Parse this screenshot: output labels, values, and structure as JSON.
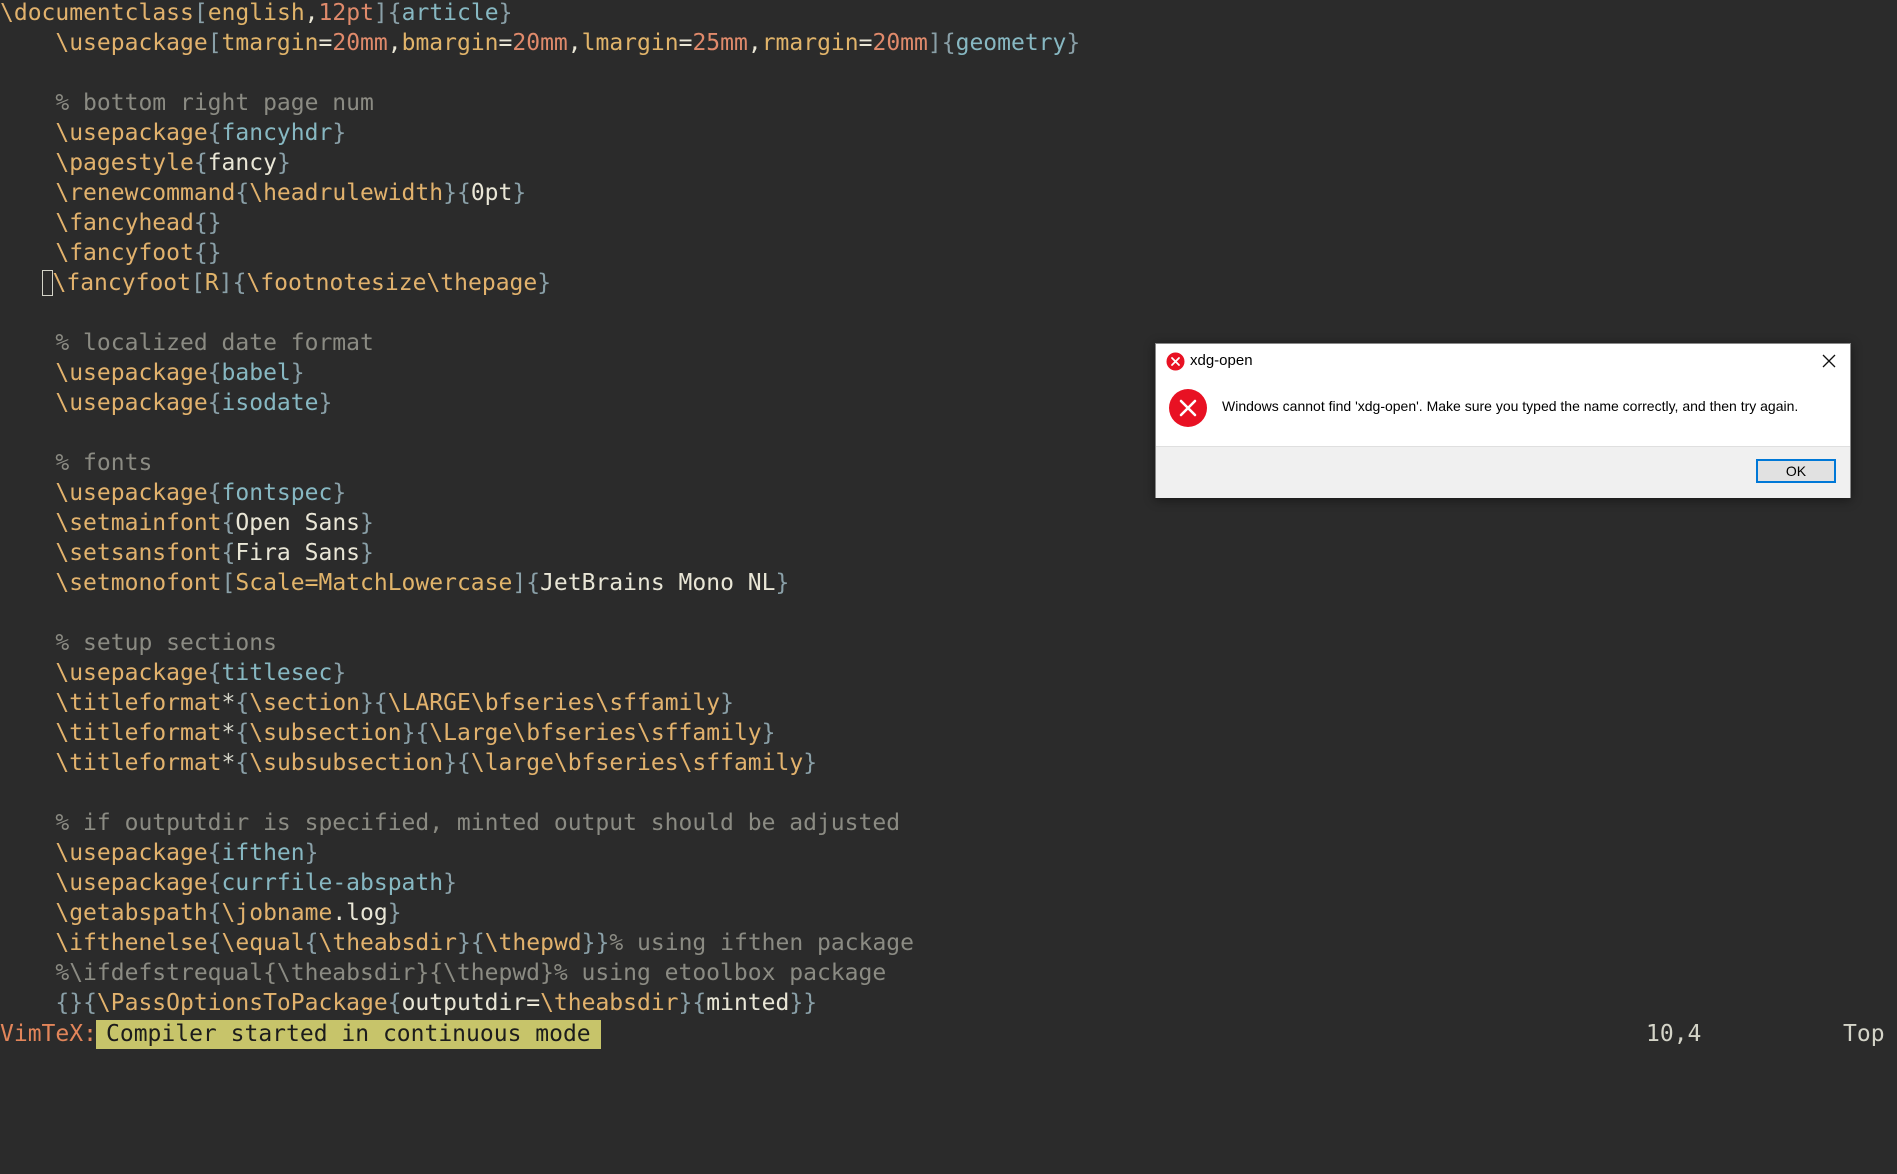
{
  "editor": {
    "lines": [
      {
        "row": 0,
        "indent": 0,
        "tokens": [
          [
            "k-cmd",
            "\\documentclass"
          ],
          [
            "k-brace",
            "["
          ],
          [
            "k-opt",
            "english"
          ],
          [
            "k-plain",
            ","
          ],
          [
            "k-val",
            "12pt"
          ],
          [
            "k-brace",
            "]"
          ],
          [
            "k-brace",
            "{"
          ],
          [
            "k-arg",
            "article"
          ],
          [
            "k-brace",
            "}"
          ]
        ]
      },
      {
        "row": 1,
        "indent": 4,
        "tokens": [
          [
            "k-cmd",
            "\\usepackage"
          ],
          [
            "k-brace",
            "["
          ],
          [
            "k-opt",
            "tmargin"
          ],
          [
            "k-plain",
            "="
          ],
          [
            "k-val",
            "20mm"
          ],
          [
            "k-plain",
            ","
          ],
          [
            "k-opt",
            "bmargin"
          ],
          [
            "k-plain",
            "="
          ],
          [
            "k-val",
            "20mm"
          ],
          [
            "k-plain",
            ","
          ],
          [
            "k-opt",
            "lmargin"
          ],
          [
            "k-plain",
            "="
          ],
          [
            "k-val",
            "25mm"
          ],
          [
            "k-plain",
            ","
          ],
          [
            "k-opt",
            "rmargin"
          ],
          [
            "k-plain",
            "="
          ],
          [
            "k-val",
            "20mm"
          ],
          [
            "k-brace",
            "]"
          ],
          [
            "k-brace",
            "{"
          ],
          [
            "k-arg",
            "geometry"
          ],
          [
            "k-brace",
            "}"
          ]
        ]
      },
      {
        "row": 3,
        "indent": 4,
        "tokens": [
          [
            "k-comment",
            "% bottom right page num"
          ]
        ]
      },
      {
        "row": 4,
        "indent": 4,
        "tokens": [
          [
            "k-cmd",
            "\\usepackage"
          ],
          [
            "k-brace",
            "{"
          ],
          [
            "k-arg",
            "fancyhdr"
          ],
          [
            "k-brace",
            "}"
          ]
        ]
      },
      {
        "row": 5,
        "indent": 4,
        "tokens": [
          [
            "k-cmd",
            "\\pagestyle"
          ],
          [
            "k-brace",
            "{"
          ],
          [
            "k-plain",
            "fancy"
          ],
          [
            "k-brace",
            "}"
          ]
        ]
      },
      {
        "row": 6,
        "indent": 4,
        "tokens": [
          [
            "k-cmd",
            "\\renewcommand"
          ],
          [
            "k-brace",
            "{"
          ],
          [
            "k-cmd",
            "\\headrulewidth"
          ],
          [
            "k-brace",
            "}"
          ],
          [
            "k-brace",
            "{"
          ],
          [
            "k-plain",
            "0pt"
          ],
          [
            "k-brace",
            "}"
          ]
        ]
      },
      {
        "row": 7,
        "indent": 4,
        "tokens": [
          [
            "k-cmd",
            "\\fancyhead"
          ],
          [
            "k-brace",
            "{}"
          ]
        ]
      },
      {
        "row": 8,
        "indent": 4,
        "tokens": [
          [
            "k-cmd",
            "\\fancyfoot"
          ],
          [
            "k-brace",
            "{}"
          ]
        ]
      },
      {
        "row": 9,
        "indent": 3,
        "cursor": true,
        "tokens": [
          [
            "k-cmd",
            "\\fancyfoot"
          ],
          [
            "k-brace",
            "["
          ],
          [
            "k-opt",
            "R"
          ],
          [
            "k-brace",
            "]"
          ],
          [
            "k-brace",
            "{"
          ],
          [
            "k-cmd",
            "\\footnotesize"
          ],
          [
            "k-cmd",
            "\\thepage"
          ],
          [
            "k-brace",
            "}"
          ]
        ]
      },
      {
        "row": 11,
        "indent": 4,
        "tokens": [
          [
            "k-comment",
            "% localized date format"
          ]
        ]
      },
      {
        "row": 12,
        "indent": 4,
        "tokens": [
          [
            "k-cmd",
            "\\usepackage"
          ],
          [
            "k-brace",
            "{"
          ],
          [
            "k-arg",
            "babel"
          ],
          [
            "k-brace",
            "}"
          ]
        ]
      },
      {
        "row": 13,
        "indent": 4,
        "tokens": [
          [
            "k-cmd",
            "\\usepackage"
          ],
          [
            "k-brace",
            "{"
          ],
          [
            "k-arg",
            "isodate"
          ],
          [
            "k-brace",
            "}"
          ]
        ]
      },
      {
        "row": 15,
        "indent": 4,
        "tokens": [
          [
            "k-comment",
            "% fonts"
          ]
        ]
      },
      {
        "row": 16,
        "indent": 4,
        "tokens": [
          [
            "k-cmd",
            "\\usepackage"
          ],
          [
            "k-brace",
            "{"
          ],
          [
            "k-arg",
            "fontspec"
          ],
          [
            "k-brace",
            "}"
          ]
        ]
      },
      {
        "row": 17,
        "indent": 4,
        "tokens": [
          [
            "k-cmd",
            "\\setmainfont"
          ],
          [
            "k-brace",
            "{"
          ],
          [
            "k-plain",
            "Open Sans"
          ],
          [
            "k-brace",
            "}"
          ]
        ]
      },
      {
        "row": 18,
        "indent": 4,
        "tokens": [
          [
            "k-cmd",
            "\\setsansfont"
          ],
          [
            "k-brace",
            "{"
          ],
          [
            "k-plain",
            "Fira Sans"
          ],
          [
            "k-brace",
            "}"
          ]
        ]
      },
      {
        "row": 19,
        "indent": 4,
        "tokens": [
          [
            "k-cmd",
            "\\setmonofont"
          ],
          [
            "k-brace",
            "["
          ],
          [
            "k-opt",
            "Scale=MatchLowercase"
          ],
          [
            "k-brace",
            "]"
          ],
          [
            "k-brace",
            "{"
          ],
          [
            "k-plain",
            "JetBrains Mono NL"
          ],
          [
            "k-brace",
            "}"
          ]
        ]
      },
      {
        "row": 21,
        "indent": 4,
        "tokens": [
          [
            "k-comment",
            "% setup sections"
          ]
        ]
      },
      {
        "row": 22,
        "indent": 4,
        "tokens": [
          [
            "k-cmd",
            "\\usepackage"
          ],
          [
            "k-brace",
            "{"
          ],
          [
            "k-arg",
            "titlesec"
          ],
          [
            "k-brace",
            "}"
          ]
        ]
      },
      {
        "row": 23,
        "indent": 4,
        "tokens": [
          [
            "k-cmd",
            "\\titleformat"
          ],
          [
            "k-star",
            "*"
          ],
          [
            "k-brace",
            "{"
          ],
          [
            "k-cmd",
            "\\section"
          ],
          [
            "k-brace",
            "}"
          ],
          [
            "k-brace",
            "{"
          ],
          [
            "k-cmd",
            "\\LARGE"
          ],
          [
            "k-cmd",
            "\\bfseries"
          ],
          [
            "k-cmd",
            "\\sffamily"
          ],
          [
            "k-brace",
            "}"
          ]
        ]
      },
      {
        "row": 24,
        "indent": 4,
        "tokens": [
          [
            "k-cmd",
            "\\titleformat"
          ],
          [
            "k-star",
            "*"
          ],
          [
            "k-brace",
            "{"
          ],
          [
            "k-cmd",
            "\\subsection"
          ],
          [
            "k-brace",
            "}"
          ],
          [
            "k-brace",
            "{"
          ],
          [
            "k-cmd",
            "\\Large"
          ],
          [
            "k-cmd",
            "\\bfseries"
          ],
          [
            "k-cmd",
            "\\sffamily"
          ],
          [
            "k-brace",
            "}"
          ]
        ]
      },
      {
        "row": 25,
        "indent": 4,
        "tokens": [
          [
            "k-cmd",
            "\\titleformat"
          ],
          [
            "k-star",
            "*"
          ],
          [
            "k-brace",
            "{"
          ],
          [
            "k-cmd",
            "\\subsubsection"
          ],
          [
            "k-brace",
            "}"
          ],
          [
            "k-brace",
            "{"
          ],
          [
            "k-cmd",
            "\\large"
          ],
          [
            "k-cmd",
            "\\bfseries"
          ],
          [
            "k-cmd",
            "\\sffamily"
          ],
          [
            "k-brace",
            "}"
          ]
        ]
      },
      {
        "row": 27,
        "indent": 4,
        "tokens": [
          [
            "k-comment",
            "% if outputdir is specified, minted output should be adjusted"
          ]
        ]
      },
      {
        "row": 28,
        "indent": 4,
        "tokens": [
          [
            "k-cmd",
            "\\usepackage"
          ],
          [
            "k-brace",
            "{"
          ],
          [
            "k-arg",
            "ifthen"
          ],
          [
            "k-brace",
            "}"
          ]
        ]
      },
      {
        "row": 29,
        "indent": 4,
        "tokens": [
          [
            "k-cmd",
            "\\usepackage"
          ],
          [
            "k-brace",
            "{"
          ],
          [
            "k-arg",
            "currfile-abspath"
          ],
          [
            "k-brace",
            "}"
          ]
        ]
      },
      {
        "row": 30,
        "indent": 4,
        "tokens": [
          [
            "k-cmd",
            "\\getabspath"
          ],
          [
            "k-brace",
            "{"
          ],
          [
            "k-cmd",
            "\\jobname"
          ],
          [
            "k-plain",
            ".log"
          ],
          [
            "k-brace",
            "}"
          ]
        ]
      },
      {
        "row": 31,
        "indent": 4,
        "tokens": [
          [
            "k-cmd",
            "\\ifthenelse"
          ],
          [
            "k-brace",
            "{"
          ],
          [
            "k-cmd",
            "\\equal"
          ],
          [
            "k-brace",
            "{"
          ],
          [
            "k-cmd",
            "\\theabsdir"
          ],
          [
            "k-brace",
            "}"
          ],
          [
            "k-brace",
            "{"
          ],
          [
            "k-cmd",
            "\\thepwd"
          ],
          [
            "k-brace",
            "}}"
          ],
          [
            "k-comment",
            "% using ifthen package"
          ]
        ]
      },
      {
        "row": 32,
        "indent": 4,
        "tokens": [
          [
            "k-comment",
            "%\\ifdefstrequal{\\theabsdir}{\\thepwd}% using etoolbox package"
          ]
        ]
      },
      {
        "row": 33,
        "indent": 4,
        "tokens": [
          [
            "k-brace",
            "{}"
          ],
          [
            "k-brace",
            "{"
          ],
          [
            "k-cmd",
            "\\PassOptionsToPackage"
          ],
          [
            "k-brace",
            "{"
          ],
          [
            "k-plain",
            "outputdir="
          ],
          [
            "k-cmd",
            "\\theabsdir"
          ],
          [
            "k-brace",
            "}"
          ],
          [
            "k-brace",
            "{"
          ],
          [
            "k-plain",
            "minted"
          ],
          [
            "k-brace",
            "}}"
          ]
        ]
      }
    ]
  },
  "statusline": {
    "prefix": "VimTeX:",
    "message": "Compiler started in continuous mode",
    "position": "10,4",
    "scroll": "Top"
  },
  "dialog": {
    "title": "xdg-open",
    "message": "Windows cannot find 'xdg-open'. Make sure you typed the name correctly, and then try again.",
    "ok_label": "OK",
    "error_color": "#e81123",
    "focus_color": "#0078d7"
  }
}
